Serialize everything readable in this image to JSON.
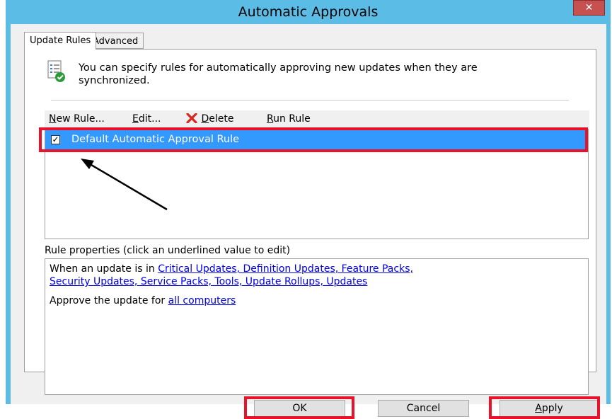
{
  "window": {
    "title": "Automatic Approvals",
    "close_glyph": "✕"
  },
  "tabs": [
    {
      "label": "Update Rules",
      "active": true
    },
    {
      "label": "Advanced",
      "active": false
    }
  ],
  "info": {
    "icon": "rules-doc-check-icon",
    "text": "You can specify rules for automatically approving new updates when they are synchronized."
  },
  "toolbar": {
    "new_rule": {
      "label_rest": "ew Rule...",
      "mnemonic": "N"
    },
    "edit": {
      "label_rest": "dit...",
      "mnemonic": "E"
    },
    "delete": {
      "label_rest": "elete",
      "mnemonic": "D",
      "icon": "red-x-delete-icon"
    },
    "run_rule": {
      "label_rest": "un Rule",
      "mnemonic": "R"
    }
  },
  "rules": [
    {
      "label": "Default Automatic Approval Rule",
      "checked": true,
      "selected": true
    }
  ],
  "properties": {
    "label": "Rule properties (click an underlined value to edit)",
    "line1_prefix": "When an update is in ",
    "classifications_a": "Critical Updates, Definition Updates, Feature Packs,",
    "classifications_b": "Security Updates, Service Packs, Tools, Update Rollups, Updates",
    "line2_prefix": "Approve the update for ",
    "computers": "all computers"
  },
  "buttons": {
    "ok": "OK",
    "cancel": "Cancel",
    "apply": {
      "label_rest": "pply",
      "mnemonic": "A"
    }
  },
  "colors": {
    "titlebar": "#5bbde6",
    "selection": "#3399ff",
    "highlight": "#e8132b",
    "link": "#0000ee",
    "close": "#c75050"
  }
}
